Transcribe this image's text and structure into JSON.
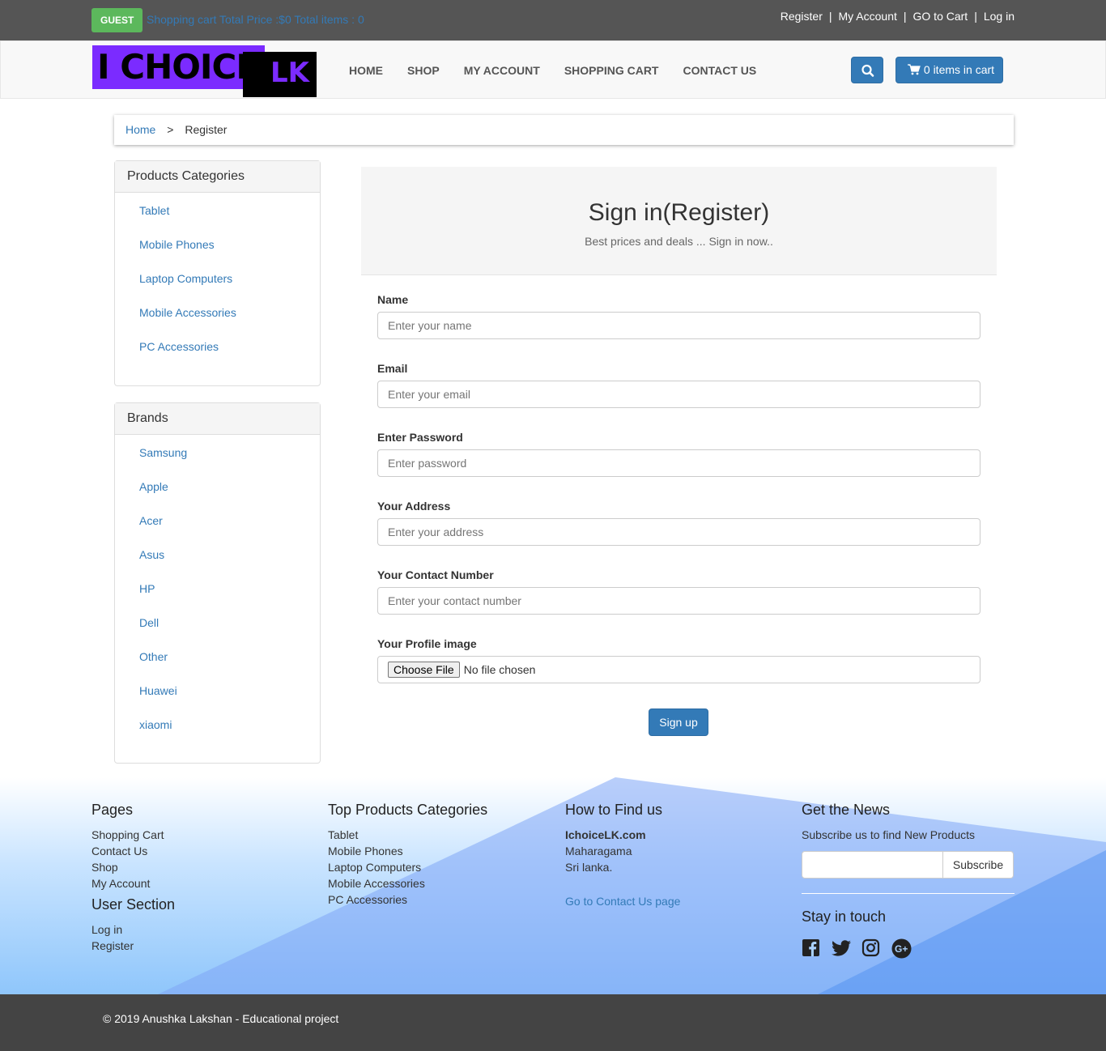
{
  "topbar": {
    "guest": "GUEST",
    "cart_summary": "Shopping cart Total Price :$0 Total items : 0",
    "links": [
      "Register",
      "My Account",
      "GO to Cart",
      "Log in"
    ],
    "separator": "|"
  },
  "navbar": {
    "logo_text_1": "I CHOICE",
    "logo_text_2": "LK",
    "menu": [
      "HOME",
      "SHOP",
      "MY ACCOUNT",
      "SHOPPING CART",
      "CONTACT US"
    ],
    "cart_button": "0 items in cart"
  },
  "breadcrumb": {
    "home": "Home",
    "separator": ">",
    "current": "Register"
  },
  "categories": {
    "title": "Products Categories",
    "items": [
      "Tablet",
      "Mobile Phones",
      "Laptop Computers",
      "Mobile Accessories",
      "PC Accessories"
    ]
  },
  "brands": {
    "title": "Brands",
    "items": [
      "Samsung",
      "Apple",
      "Acer",
      "Asus",
      "HP",
      "Dell",
      "Other",
      "Huawei",
      "xiaomi"
    ]
  },
  "form": {
    "title": "Sign in(Register)",
    "subtitle": "Best prices and deals ... Sign in now..",
    "name": {
      "label": "Name",
      "placeholder": "Enter your name"
    },
    "email": {
      "label": "Email",
      "placeholder": "Enter your email"
    },
    "password": {
      "label": "Enter Password",
      "placeholder": "Enter password"
    },
    "address": {
      "label": "Your Address",
      "placeholder": "Enter your address"
    },
    "contact": {
      "label": "Your Contact Number",
      "placeholder": "Enter your contact number"
    },
    "image": {
      "label": "Your Profile image",
      "button": "Choose File",
      "status": "No file chosen"
    },
    "submit": "Sign up"
  },
  "footer": {
    "pages": {
      "title": "Pages",
      "items": [
        "Shopping Cart",
        "Contact Us",
        "Shop",
        "My Account"
      ]
    },
    "user_section": {
      "title": "User Section",
      "items": [
        "Log in",
        "Register"
      ]
    },
    "top_categories": {
      "title": "Top Products Categories",
      "items": [
        "Tablet",
        "Mobile Phones",
        "Laptop Computers",
        "Mobile Accessories",
        "PC Accessories"
      ]
    },
    "find_us": {
      "title": "How to Find us",
      "name": "IchoiceLK.com",
      "city": "Maharagama",
      "country": "Sri lanka.",
      "contact_link": "Go to Contact Us page"
    },
    "news": {
      "title": "Get the News",
      "text": "Subscribe us to find New Products",
      "button": "Subscribe",
      "stay": "Stay in touch"
    },
    "social_icons": [
      "facebook-icon",
      "twitter-icon",
      "instagram-icon",
      "google-plus-icon"
    ]
  },
  "copyright": "© 2019 Anushka Lakshan - Educational project",
  "colors": {
    "primary": "#337ab7",
    "guest": "#5cb85c",
    "topbar": "#555555",
    "logo_purple": "#7b2bff"
  }
}
